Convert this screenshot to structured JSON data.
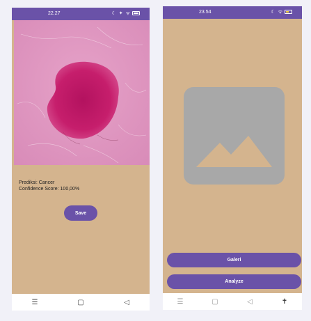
{
  "left_screen": {
    "status": {
      "time": "22.27",
      "icons": "☾ ✦ ᯤ"
    },
    "prediction_text": "Prediksi: Cancer",
    "confidence_text": "Confidence Score: 100,00%",
    "save_label": "Save",
    "nav": {
      "menu": "☰",
      "home": "▢",
      "back": "◁"
    }
  },
  "right_screen": {
    "status": {
      "time": "23.54",
      "icons": "☾ ᯤ"
    },
    "galeri_label": "Galeri",
    "analyze_label": "Analyze",
    "nav": {
      "menu": "☰",
      "home": "▢",
      "back": "◁",
      "accessibility": "✝"
    }
  },
  "colors": {
    "accent": "#6a52a8",
    "background": "#d4b48e",
    "placeholder": "#a8a8a8"
  },
  "icons": [
    "skin-lesion-photo",
    "image-placeholder-icon",
    "battery-icon",
    "wifi-icon",
    "moon-icon"
  ]
}
